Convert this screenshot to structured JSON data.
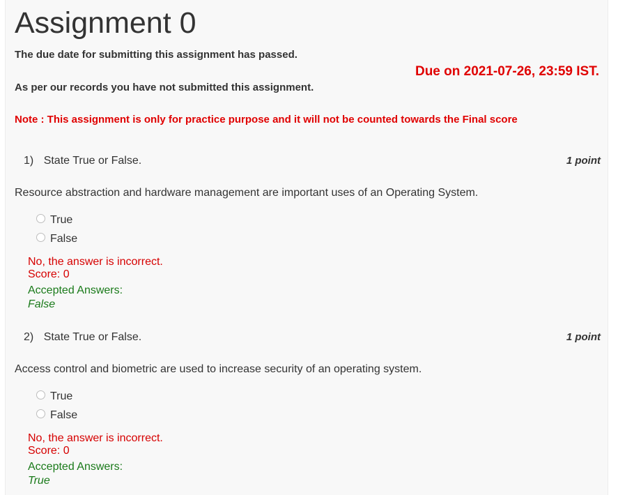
{
  "assignment": {
    "title": "Assignment 0",
    "due_passed_text": "The due date for submitting this assignment has passed.",
    "not_submitted_text": "As per our records you have not submitted this assignment.",
    "due_date_text": "Due on 2021-07-26, 23:59 IST.",
    "note_text": "Note : This assignment is only for practice purpose and it will not be counted towards the Final score"
  },
  "questions": [
    {
      "number": "1)",
      "prompt": "State True or False.",
      "points": "1 point",
      "text": "Resource abstraction and hardware management are important uses of an Operating System.",
      "options": [
        "True",
        "False"
      ],
      "feedback": "No, the answer is incorrect.",
      "score": "Score: 0",
      "accepted_label": "Accepted Answers:",
      "accepted_value": "False"
    },
    {
      "number": "2)",
      "prompt": "State True or False.",
      "points": "1 point",
      "text": "Access control and biometric are used to increase security of an operating system.",
      "options": [
        "True",
        "False"
      ],
      "feedback": "No, the answer is incorrect.",
      "score": "Score: 0",
      "accepted_label": "Accepted Answers:",
      "accepted_value": "True"
    }
  ],
  "colors": {
    "alert_red": "#e00000",
    "accepted_green": "#1a7a1a",
    "panel_bg": "#f8f8f8"
  }
}
